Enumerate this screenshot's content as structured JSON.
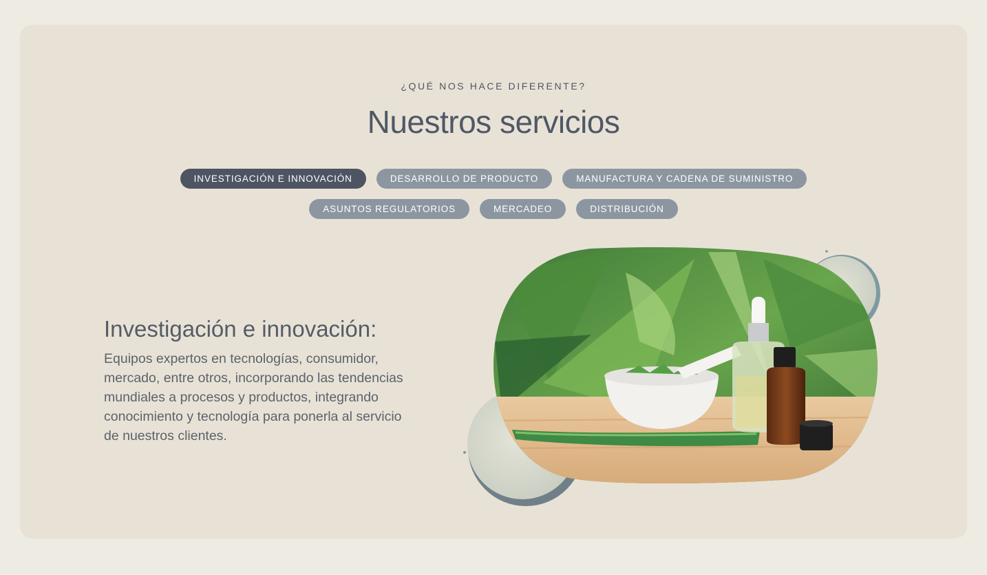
{
  "section": {
    "eyebrow": "¿QUÉ NOS HACE DIFERENTE?",
    "title": "Nuestros servicios"
  },
  "tabs": [
    {
      "label": "INVESTIGACIÓN E INNOVACIÓN",
      "active": true
    },
    {
      "label": "DESARROLLO DE PRODUCTO",
      "active": false
    },
    {
      "label": "MANUFACTURA Y CADENA DE SUMINISTRO",
      "active": false
    },
    {
      "label": "ASUNTOS REGULATORIOS",
      "active": false
    },
    {
      "label": "MERCADEO",
      "active": false
    },
    {
      "label": "DISTRIBUCIÓN",
      "active": false
    }
  ],
  "content": {
    "heading": "Investigación e innovación:",
    "body": "Equipos expertos en tecnologías, consumidor, mercado, entre otros, incorporando las tendencias mundiales a procesos y productos, integrando conocimiento y tecnología para ponerla al servicio de nuestros clientes."
  },
  "colors": {
    "page_bg": "#eeebe3",
    "card_bg": "#e8e2d6",
    "tab_active": "#4d5462",
    "tab_inactive": "#8c96a1",
    "text_dark": "#4f5866"
  }
}
